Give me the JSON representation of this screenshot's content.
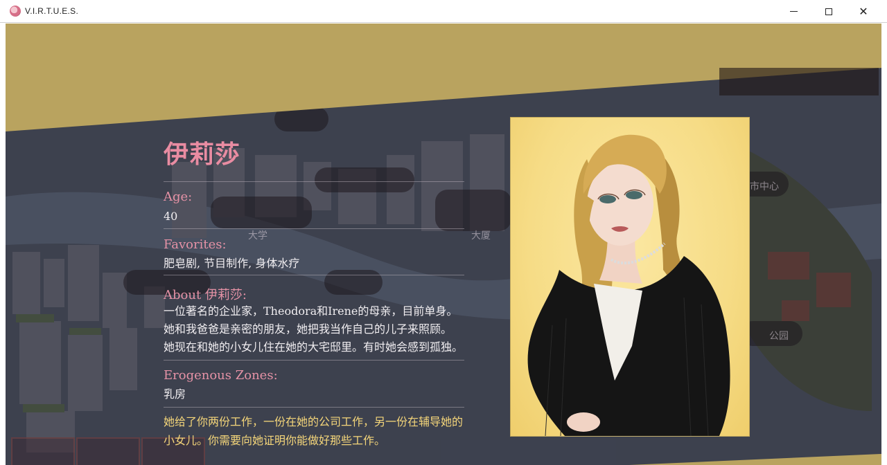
{
  "window": {
    "title": "V.I.R.T.U.E.S.",
    "minimize_icon": "minimize-icon",
    "maximize_icon": "maximize-icon",
    "close_icon": "close-icon"
  },
  "colors": {
    "banner": "#b9a35f",
    "name": "#e98ca2",
    "label": "#e592a6",
    "quest": "#f5d67a",
    "portrait_bg": "#f6dc86"
  },
  "map": {
    "labels": [
      "大学",
      "大厦",
      "市中心",
      "公园"
    ]
  },
  "character": {
    "name": "伊莉莎",
    "age_label": "Age:",
    "age": "40",
    "favorites_label": "Favorites:",
    "favorites": "肥皂剧, 节目制作, 身体水疗",
    "about_label": "About 伊莉莎:",
    "about_lines": [
      "一位著名的企业家，Theodora和Irene的母亲，目前单身。",
      "她和我爸爸是亲密的朋友，她把我当作自己的儿子来照顾。",
      "她现在和她的小女儿住在她的大宅邸里。有时她会感到孤独。"
    ],
    "erogenous_label": "Erogenous Zones:",
    "erogenous": "乳房",
    "quest_lines": [
      "她给了你两份工作，一份在她的公司工作，另一份在辅导她的",
      "小女儿。你需要向她证明你能做好那些工作。"
    ]
  }
}
